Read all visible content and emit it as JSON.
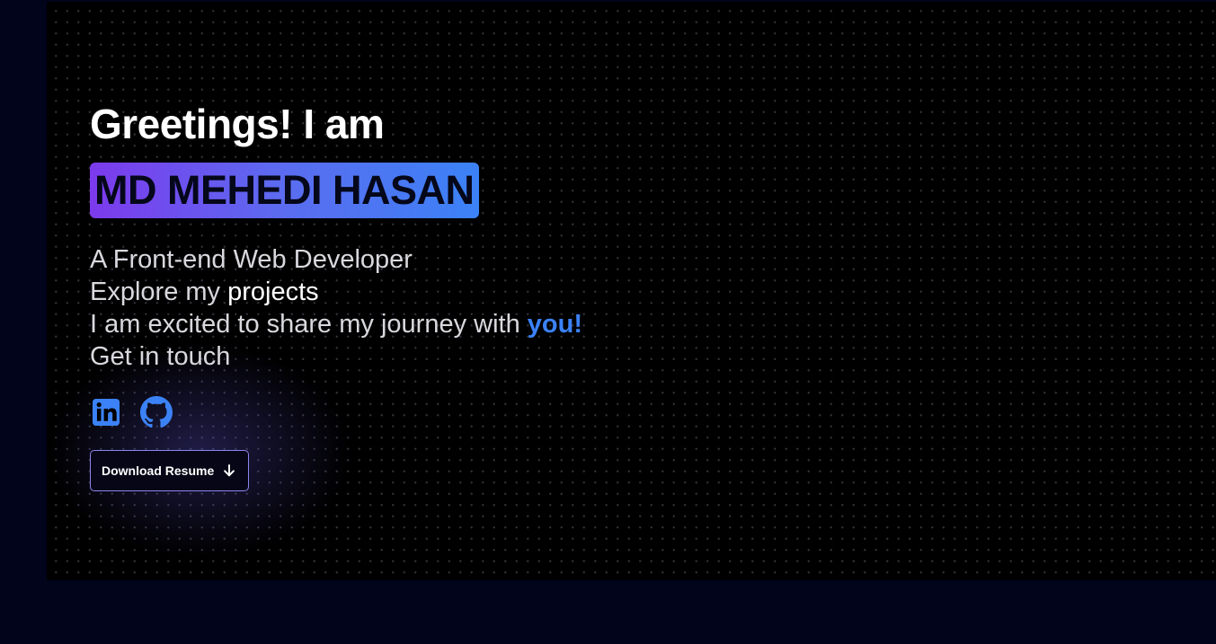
{
  "hero": {
    "greeting": "Greetings! I am",
    "name": "MD MEHEDI HASAN",
    "role_line": "A Front-end Web Developer",
    "explore_prefix": "Explore my ",
    "explore_link": "projects",
    "journey_prefix": "I am excited to share my journey with ",
    "journey_highlight": "you!",
    "contact_line": "Get in touch"
  },
  "socials": [
    {
      "name": "linkedin",
      "icon": "linkedin-icon"
    },
    {
      "name": "github",
      "icon": "github-icon"
    }
  ],
  "resume_button": {
    "label": "Download Resume",
    "icon": "arrow-down-icon"
  },
  "colors": {
    "page_background": "#01041a",
    "hero_background": "#000000",
    "accent_blue": "#3b82f6",
    "accent_purple": "#7c3aed",
    "button_border": "#8b86f0"
  }
}
